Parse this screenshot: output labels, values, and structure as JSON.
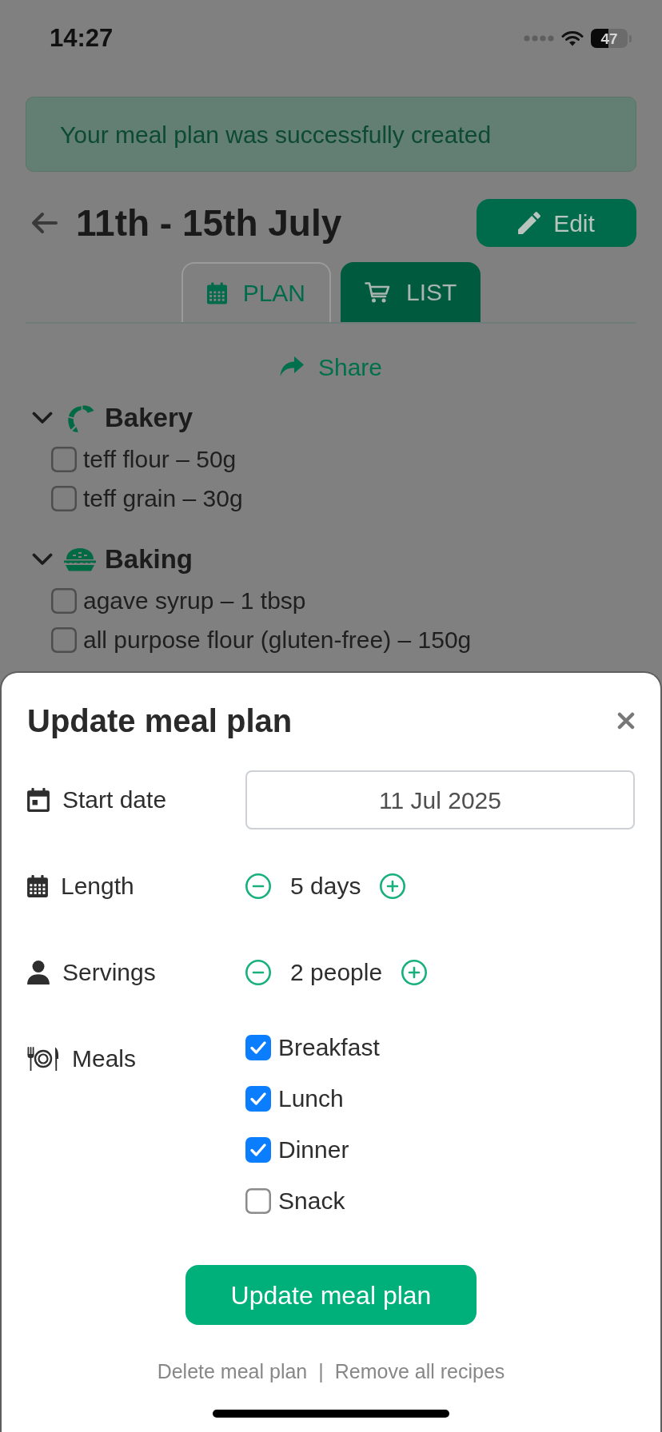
{
  "status_bar": {
    "time": "14:27",
    "battery": "47"
  },
  "alert": {
    "text": "Your meal plan was successfully created"
  },
  "header": {
    "title": "11th - 15th July",
    "edit_button": "Edit"
  },
  "tabs": [
    {
      "label": "PLAN",
      "selected": false
    },
    {
      "label": "LIST",
      "selected": true
    }
  ],
  "share_button": "Share",
  "shopping_list": [
    {
      "category": "Bakery",
      "expanded": true,
      "items": [
        {
          "text": "teff flour – 50g",
          "checked": false
        },
        {
          "text": "teff grain – 30g",
          "checked": false
        }
      ]
    },
    {
      "category": "Baking",
      "expanded": true,
      "items": [
        {
          "text": "agave syrup – 1 tbsp",
          "checked": false
        },
        {
          "text": "all purpose flour (gluten-free) – 150g",
          "checked": false
        }
      ]
    }
  ],
  "modal": {
    "title": "Update meal plan",
    "fields": [
      {
        "kind": "date",
        "label": "Start date",
        "value": "11 Jul 2025"
      },
      {
        "kind": "stepper",
        "label": "Length",
        "value": "5 days"
      },
      {
        "kind": "stepper",
        "label": "Servings",
        "value": "2 people"
      },
      {
        "kind": "checklist",
        "label": "Meals",
        "options": [
          {
            "label": "Breakfast",
            "checked": true
          },
          {
            "label": "Lunch",
            "checked": true
          },
          {
            "label": "Dinner",
            "checked": true
          },
          {
            "label": "Snack",
            "checked": false
          }
        ]
      }
    ],
    "submit_button": "Update meal plan",
    "links": [
      "Delete meal plan",
      "Remove all recipes"
    ],
    "link_separator": "|"
  }
}
